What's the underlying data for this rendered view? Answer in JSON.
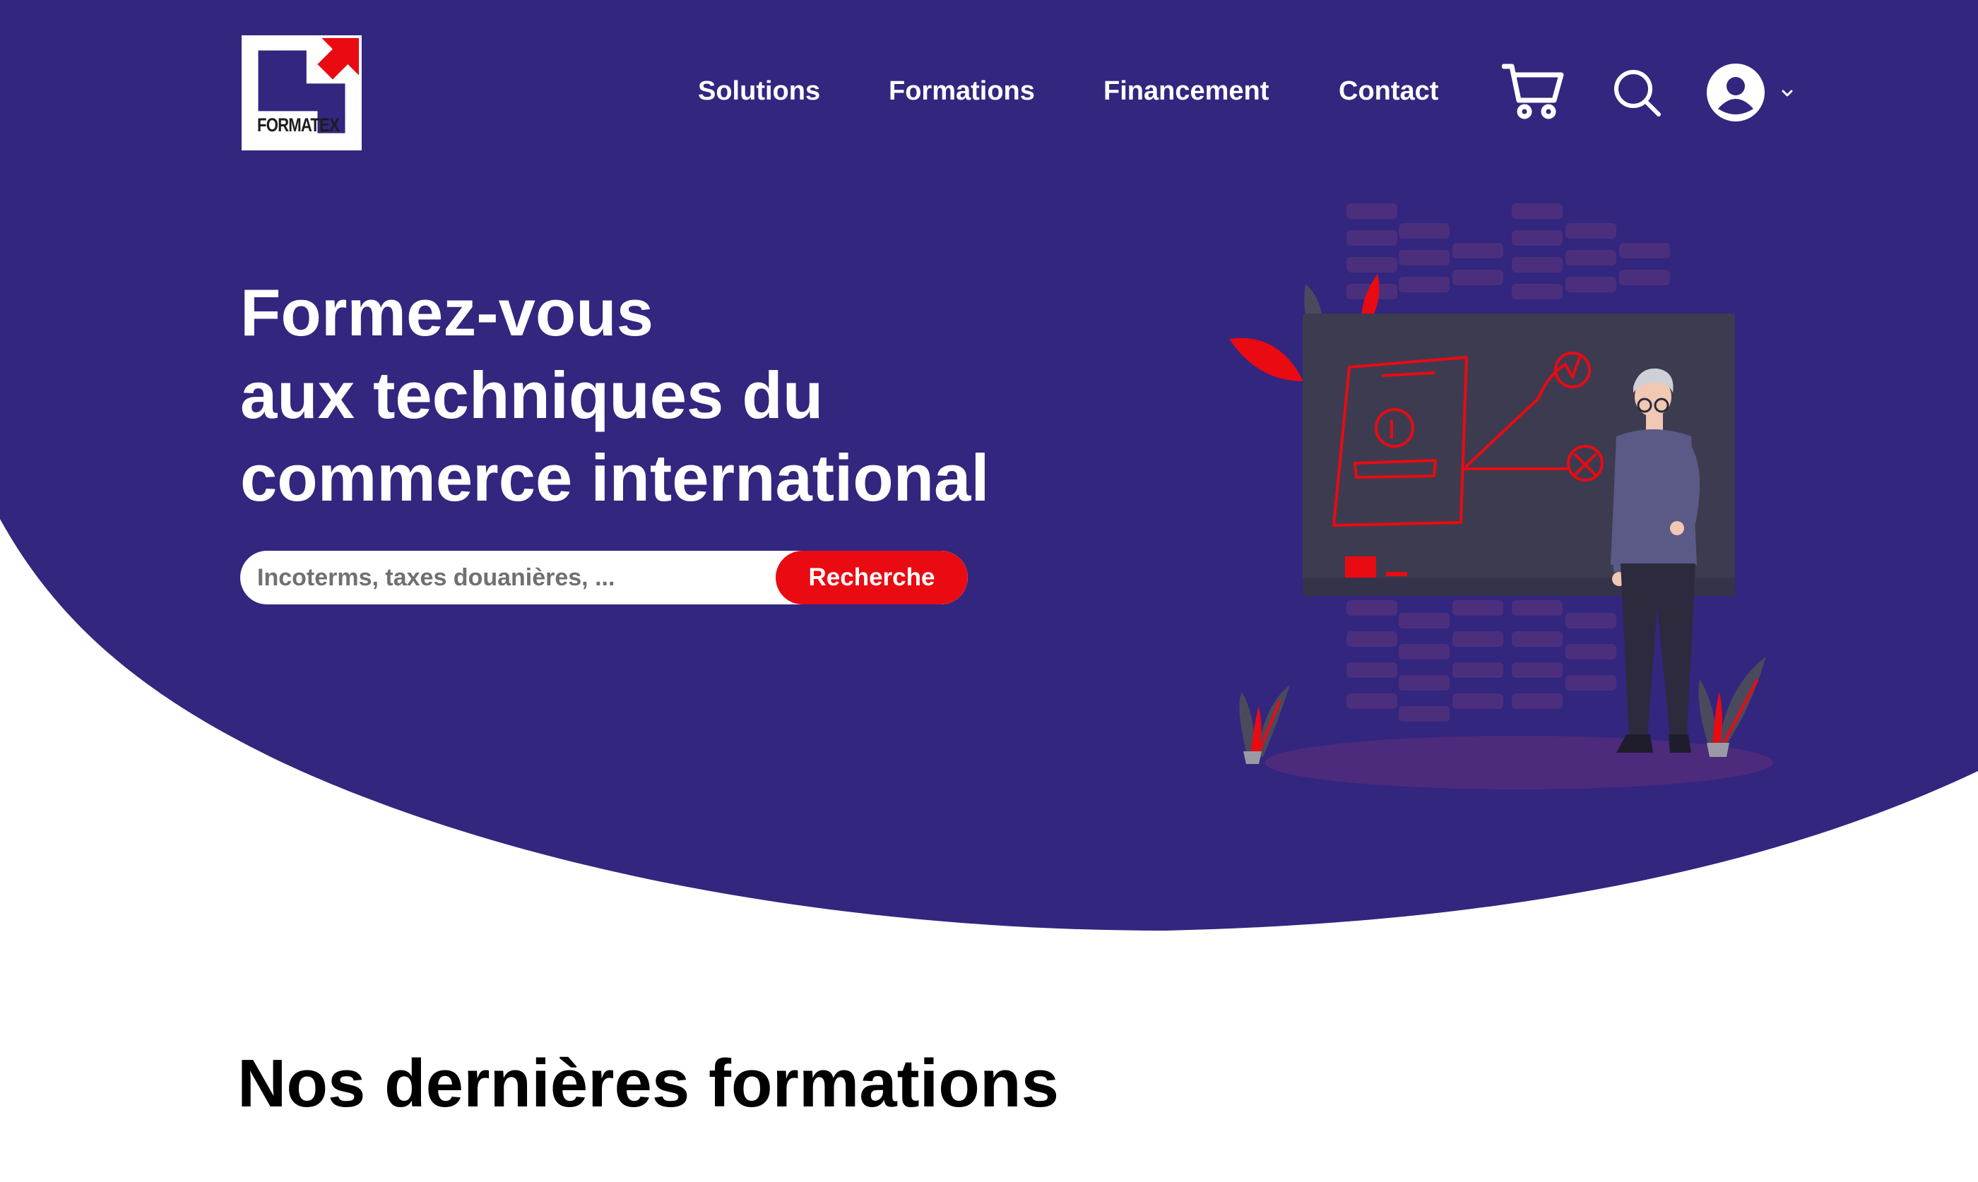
{
  "brand": {
    "name": "FORMATEX",
    "logo_text": "FORMATEX"
  },
  "colors": {
    "primary": "#32267f",
    "accent": "#ea0a12",
    "text_dark": "#000000",
    "white": "#ffffff"
  },
  "nav": {
    "items": [
      {
        "label": "Solutions"
      },
      {
        "label": "Formations"
      },
      {
        "label": "Financement"
      },
      {
        "label": "Contact"
      }
    ],
    "icons": [
      "cart-icon",
      "search-icon",
      "user-icon",
      "chevron-down-icon"
    ]
  },
  "hero": {
    "title_lines": [
      "Formez-vous",
      "aux techniques du",
      "commerce international"
    ],
    "search": {
      "placeholder": "Incoterms, taxes douanières, ...",
      "button_label": "Recherche"
    }
  },
  "section": {
    "title": "Nos dernières formations"
  }
}
